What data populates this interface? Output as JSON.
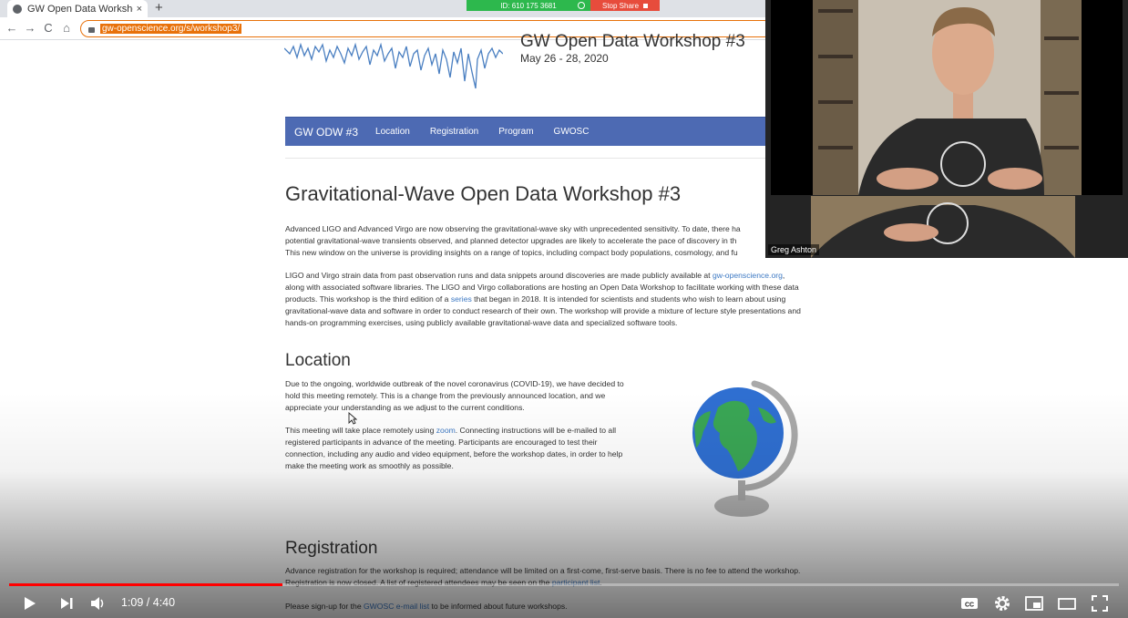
{
  "browser": {
    "tab_title": "GW Open Data Workshoр",
    "tab_close": "×",
    "new_tab": "+",
    "url": "gw-openscience.org/s/workshop3/",
    "back": "←",
    "forward": "→",
    "reload": "C",
    "home": "⌂"
  },
  "share": {
    "meeting_id": "ID: 610 175 3681",
    "stop_label": "Stop Share"
  },
  "page": {
    "top_title": "GW Open Data Workshop #3",
    "dates": "May 26 - 28, 2020",
    "nav": {
      "brand": "GW ODW #3",
      "items": [
        "Location",
        "Registration",
        "Program",
        "GWOSC"
      ]
    },
    "heading": "Gravitational-Wave Open Data Workshop #3",
    "intro_lines": [
      "Advanced LIGO and Advanced Virgo are now observing the gravitational-wave sky with unprecedented sensitivity. To date, there ha",
      "potential gravitational-wave transients observed, and planned detector upgrades are likely to accelerate the pace of discovery in th",
      "This new window on the universe is providing insights on a range of topics, including compact body populations, cosmology, and fu"
    ],
    "para2": {
      "l1_text": "LIGO and Virgo strain data from past observation runs and data snippets around discoveries are made publicly available at",
      "l1_link": "gw-openscience.org",
      "l1_tail": ",",
      "l2": "along with associated software libraries. The LIGO and Virgo collaborations are hosting an Open Data Workshop to facilitate working with these data",
      "l3_a": "products. This workshop is the third edition of a",
      "l3_link": "series",
      "l3_b": "that began in 2018. It is intended for scientists and students who wish to learn about using",
      "l4": "gravitational-wave data and software in order to conduct research of their own. The workshop will provide a mixture of lecture style presentations and",
      "l5": "hands-on programming exercises, using publicly available gravitational-wave data and specialized software tools."
    },
    "location": {
      "heading": "Location",
      "p1_lines": [
        "Due to the ongoing, worldwide outbreak of the novel coronavirus (COVID-19), we have decided to",
        "hold this meeting remotely. This is a change from the previously announced location, and we",
        "appreciate your understanding as we adjust to the current conditions."
      ],
      "p2_a": "This meeting will take place remotely using",
      "p2_link": "zoom",
      "p2_b": ". Connecting instructions will be e-mailed to all",
      "p2_lines": [
        "registered participants in advance of the meeting. Participants are encouraged to test their",
        "connection, including any audio and video equipment, before the workshop dates, in order to help",
        "make the meeting work as smoothly as possible."
      ]
    },
    "registration": {
      "heading": "Registration",
      "l1": "Advance registration for the workshop is required; attendance will be limited on a first-come, first-serve basis. There is no fee to attend the workshop.",
      "l2_a": "Registration is now closed. A list of registered attendees may be seen on the",
      "l2_link": "participant list",
      "l2_tail": ".",
      "l3_a": "Please sign-up for the",
      "l3_link": "GWOSC e-mail list",
      "l3_b": "to be informed about future workshops."
    }
  },
  "webcam": {
    "participant_name": "Greg Ashton"
  },
  "player": {
    "time": "1:09 / 4:40",
    "progress_fraction": 0.246,
    "icons": [
      "play-icon",
      "next-icon",
      "volume-icon",
      "captions-icon",
      "settings-icon",
      "miniplayer-icon",
      "theater-icon",
      "fullscreen-icon"
    ],
    "accent": "#ff0000"
  },
  "colors": {
    "site_nav": "#4d6ab3",
    "link": "#3c78c3",
    "url_highlight": "#e8710a",
    "share_green": "#2db84d",
    "share_red": "#e74c3c"
  }
}
